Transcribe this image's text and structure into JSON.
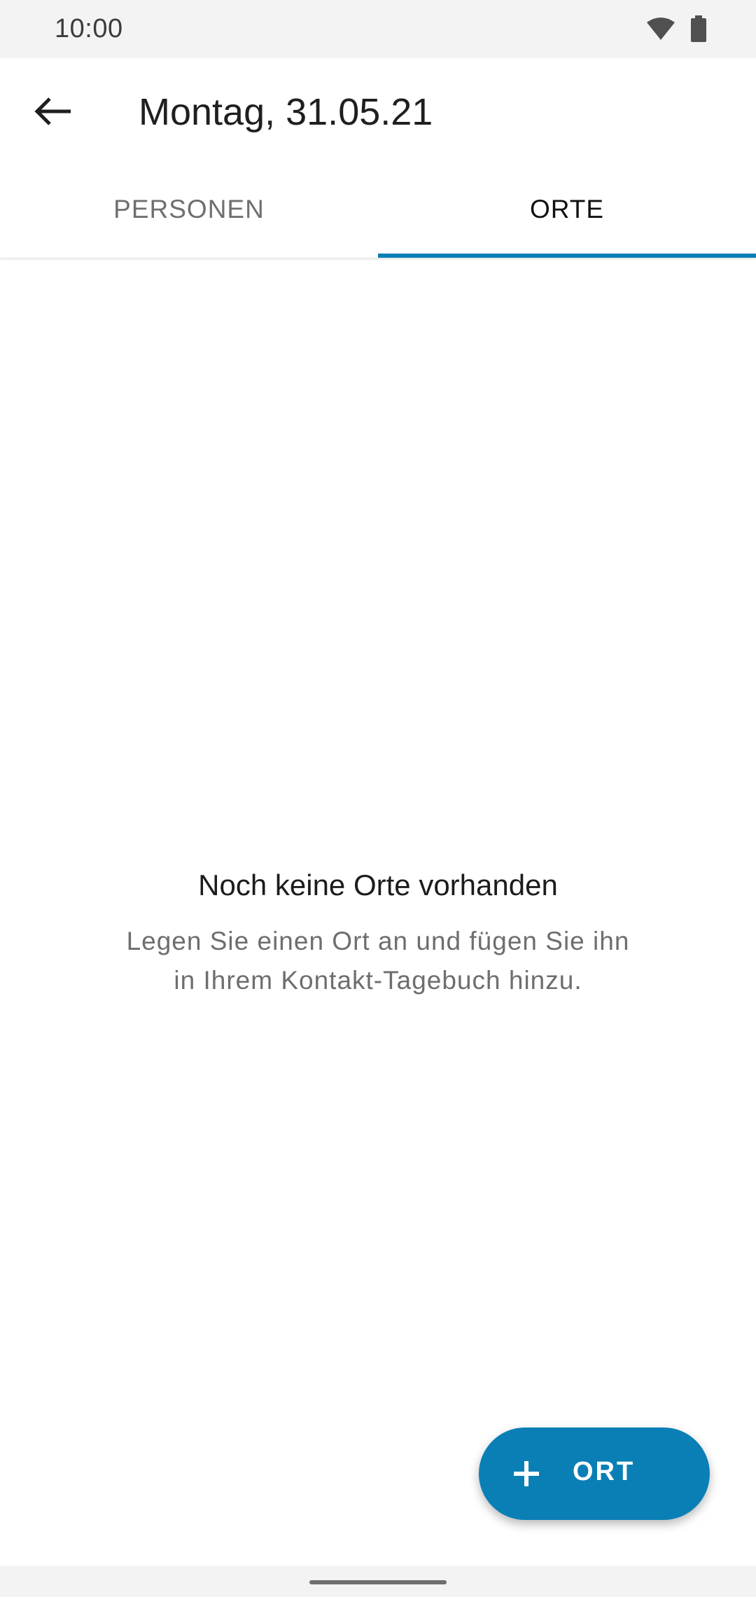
{
  "status_bar": {
    "time": "10:00",
    "icons": [
      "wifi-icon",
      "battery-icon"
    ]
  },
  "app_bar": {
    "back_icon": "arrow-back-icon",
    "title": "Montag, 31.05.21"
  },
  "tabs": [
    {
      "label": "PERSONEN",
      "active": false
    },
    {
      "label": "ORTE",
      "active": true
    }
  ],
  "empty_state": {
    "title": "Noch keine Orte vorhanden",
    "body_line1": "Legen Sie einen Ort an und fügen Sie ihn",
    "body_line2": "in Ihrem Kontakt-Tagebuch hinzu."
  },
  "fab": {
    "icon": "plus-icon",
    "label": "ORT"
  },
  "colors": {
    "accent": "#0a7fb5",
    "status_bar_bg": "#f3f3f3",
    "text_primary": "#1f1f1f",
    "text_secondary": "#6e6e6e"
  }
}
